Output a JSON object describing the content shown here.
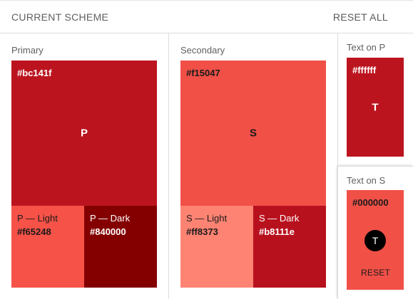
{
  "header": {
    "title": "CURRENT SCHEME",
    "reset_all_label": "RESET ALL"
  },
  "primary": {
    "label": "Primary",
    "hex": "#bc141f",
    "letter": "P",
    "color": "#bc141f",
    "light": {
      "label": "P — Light",
      "hex": "#f65248",
      "color": "#f65248"
    },
    "dark": {
      "label": "P — Dark",
      "hex": "#840000",
      "color": "#840000"
    }
  },
  "secondary": {
    "label": "Secondary",
    "hex": "#f15047",
    "letter": "S",
    "color": "#f15047",
    "light": {
      "label": "S — Light",
      "hex": "#ff8373",
      "color": "#ff8373"
    },
    "dark": {
      "label": "S — Dark",
      "hex": "#b8111e",
      "color": "#b8111e"
    }
  },
  "text_on_p": {
    "label": "Text on P",
    "hex": "#ffffff",
    "letter": "T"
  },
  "text_on_s": {
    "label": "Text on S",
    "hex": "#000000",
    "letter": "T",
    "reset_label": "RESET"
  }
}
